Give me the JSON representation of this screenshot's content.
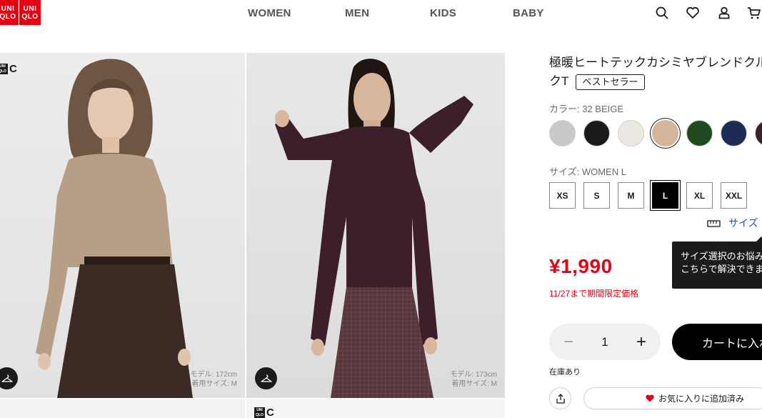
{
  "header": {
    "logo_top": "UNI",
    "logo_bottom": "QLO",
    "nav": [
      "WOMEN",
      "MEN",
      "KIDS",
      "BABY"
    ],
    "icons": [
      "search-icon",
      "heart-icon",
      "user-icon",
      "cart-icon"
    ]
  },
  "gallery": {
    "brand_mark": "C",
    "brand_box_top": "UNI",
    "brand_box_bottom": "QLO",
    "photo1": {
      "model_height": "モデル: 172cm",
      "model_size": "着用サイズ: M"
    },
    "photo2": {
      "model_height": "モデル: 173cm",
      "model_size": "着用サイズ: M"
    }
  },
  "product": {
    "title_line1": "極暖ヒートテックカシミヤブレンドクル",
    "title_line2": "クT",
    "badge": "ベストセラー",
    "color_label": "カラー: 32 BEIGE",
    "colors": [
      "#c9c9c9",
      "#1a1a1a",
      "#ebe7e1",
      "#d4b59a",
      "#1f4a1f",
      "#1d2c55",
      "#3d1f2c"
    ],
    "selected_color_index": 3,
    "size_label": "サイズ: WOMEN L",
    "sizes": [
      "XS",
      "S",
      "M",
      "L",
      "XL",
      "XXL"
    ],
    "selected_size_index": 3,
    "size_guide": "サイズ",
    "tooltip_line1": "サイズ選択のお悩み",
    "tooltip_line2": "こちらで解決できま",
    "price": "¥1,990",
    "promo": "11/27まで期間限定価格",
    "quantity": "1",
    "minus": "−",
    "plus": "+",
    "add_to_cart": "カートに入れ",
    "stock": "在庫あり",
    "favorite": "お気に入りに追加済み"
  }
}
